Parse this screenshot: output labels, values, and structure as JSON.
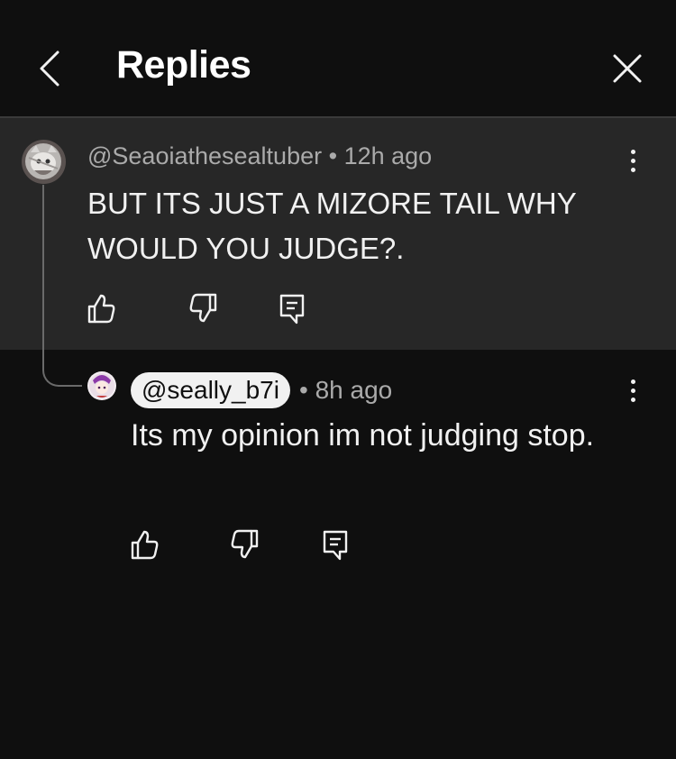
{
  "header": {
    "title": "Replies"
  },
  "parent_comment": {
    "author": "@Seaoiathesealtuber",
    "separator": "•",
    "time": "12h ago",
    "text": "BUT ITS JUST A MIZORE TAIL WHY WOULD YOU JUDGE?."
  },
  "reply": {
    "author": "@seally_b7i",
    "separator": "•",
    "time": "8h ago",
    "text": "Its my opinion im not judging stop."
  },
  "colors": {
    "background": "#0f0f0f",
    "highlight_background": "#272727",
    "text_primary": "#f1f1f1",
    "text_secondary": "#aaaaaa"
  },
  "icons": [
    "chevron-left-icon",
    "close-icon",
    "more-vertical-icon",
    "thumbs-up-icon",
    "thumbs-down-icon",
    "reply-icon"
  ]
}
